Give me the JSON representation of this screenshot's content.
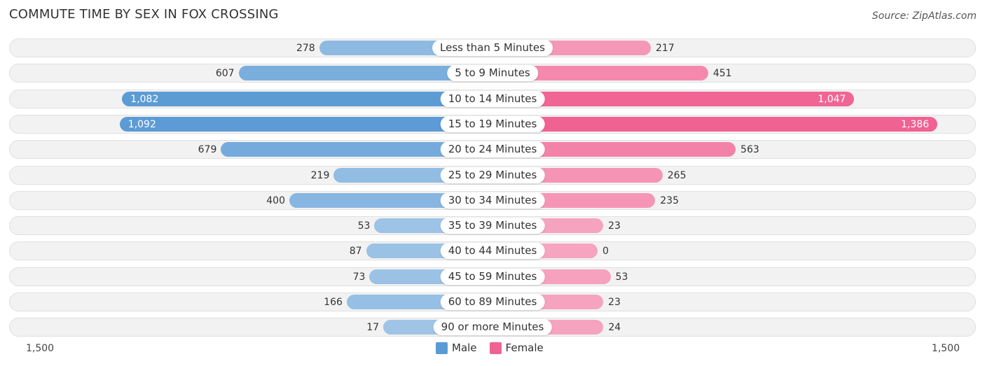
{
  "chart_data": {
    "type": "bar",
    "orientation": "horizontal-diverging",
    "title": "COMMUTE TIME BY SEX IN FOX CROSSING",
    "source": "Source: ZipAtlas.com",
    "categories": [
      "Less than 5 Minutes",
      "5 to 9 Minutes",
      "10 to 14 Minutes",
      "15 to 19 Minutes",
      "20 to 24 Minutes",
      "25 to 29 Minutes",
      "30 to 34 Minutes",
      "35 to 39 Minutes",
      "40 to 44 Minutes",
      "45 to 59 Minutes",
      "60 to 89 Minutes",
      "90 or more Minutes"
    ],
    "series": [
      {
        "name": "Male",
        "color": "#5b9bd5",
        "values": [
          278,
          607,
          1082,
          1092,
          679,
          219,
          400,
          53,
          87,
          73,
          166,
          17
        ],
        "labels": [
          "278",
          "607",
          "1,082",
          "1,092",
          "679",
          "219",
          "400",
          "53",
          "87",
          "73",
          "166",
          "17"
        ]
      },
      {
        "name": "Female",
        "color": "#f06292",
        "values": [
          217,
          451,
          1047,
          1386,
          563,
          265,
          235,
          23,
          0,
          53,
          23,
          24
        ],
        "labels": [
          "217",
          "451",
          "1,047",
          "1,386",
          "563",
          "265",
          "235",
          "23",
          "0",
          "53",
          "23",
          "24"
        ]
      }
    ],
    "axis_left_label": "1,500",
    "axis_right_label": "1,500",
    "xlim": [
      -1500,
      1500
    ],
    "legend": "bottom-center"
  }
}
